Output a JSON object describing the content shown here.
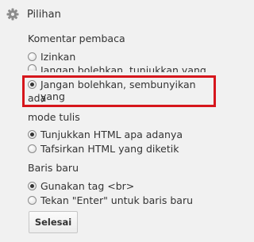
{
  "header": {
    "title": "Pilihan",
    "icon": "gear-icon"
  },
  "comment_section": {
    "title": "Komentar pembaca",
    "options": [
      "Izinkan",
      "Jangan bolehkan, tunjukkan yang ada",
      "Jangan bolehkan, sembunyikan yang",
      "ada"
    ]
  },
  "mode_section": {
    "title": "mode tulis",
    "options": [
      "Tunjukkan HTML apa adanya",
      "Tafsirkan HTML yang diketik"
    ]
  },
  "linebreak_section": {
    "title": "Baris baru",
    "options": [
      "Gunakan tag <br>",
      "Tekan \"Enter\" untuk baris baru"
    ]
  },
  "actions": {
    "done_label": "Selesai"
  },
  "colors": {
    "highlight": "#d6161c",
    "background": "#f1f1f1"
  }
}
